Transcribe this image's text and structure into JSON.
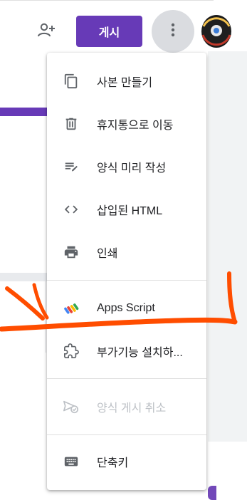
{
  "header": {
    "publish_label": "게시"
  },
  "menu": {
    "items": [
      {
        "label": "사본 만들기",
        "icon": "copy-icon",
        "disabled": false
      },
      {
        "label": "휴지통으로 이동",
        "icon": "trash-icon",
        "disabled": false
      },
      {
        "label": "양식 미리 작성",
        "icon": "prefill-icon",
        "disabled": false
      },
      {
        "label": "삽입된 HTML",
        "icon": "code-icon",
        "disabled": false
      },
      {
        "label": "인쇄",
        "icon": "print-icon",
        "disabled": false
      },
      {
        "label": "Apps Script",
        "icon": "apps-script-icon",
        "disabled": false
      },
      {
        "label": "부가기능 설치하...",
        "icon": "puzzle-icon",
        "disabled": false
      },
      {
        "label": "양식 게시 취소",
        "icon": "unpublish-icon",
        "disabled": true
      },
      {
        "label": "단축키",
        "icon": "keyboard-icon",
        "disabled": false
      }
    ]
  },
  "colors": {
    "accent": "#673ab7",
    "annotation": "#ff4d00",
    "icon": "#5f6368",
    "disabled": "#bdc1c6"
  }
}
